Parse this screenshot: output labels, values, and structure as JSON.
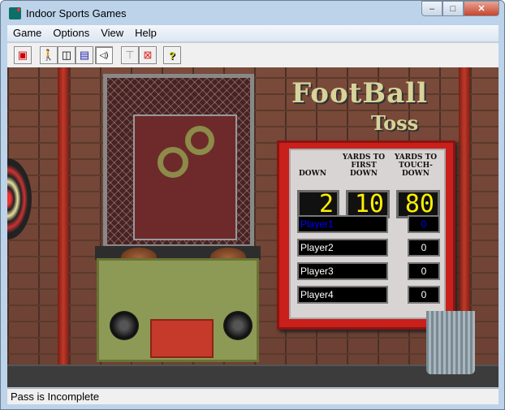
{
  "window": {
    "title": "Indoor Sports Games",
    "minimize": "–",
    "maximize": "□",
    "close": "✕"
  },
  "menu": [
    "Game",
    "Options",
    "View",
    "Help"
  ],
  "toolbar": [
    {
      "name": "new-game-icon",
      "glyph": "▣"
    },
    {
      "name": "player-icon",
      "glyph": "🚶"
    },
    {
      "name": "scoreboard-icon",
      "glyph": "◫"
    },
    {
      "name": "display-icon",
      "glyph": "▤"
    },
    {
      "name": "sound-icon",
      "glyph": "◁)"
    },
    {
      "name": "trophy-icon",
      "glyph": "⊤"
    },
    {
      "name": "no-target-icon",
      "glyph": "⊠"
    },
    {
      "name": "help-icon",
      "glyph": "?"
    }
  ],
  "game": {
    "logo_line1": "FootBall",
    "logo_line2": "Toss",
    "headers": {
      "down": "DOWN",
      "first_down": "YARDS TO FIRST DOWN",
      "touchdown": "YARDS TO TOUCH-DOWN"
    },
    "down": "2",
    "yards_first_down": "10",
    "yards_touchdown": "80",
    "players": [
      {
        "name": "Player1",
        "score": "0",
        "active": true
      },
      {
        "name": "Player2",
        "score": "0"
      },
      {
        "name": "Player3",
        "score": "0"
      },
      {
        "name": "Player4",
        "score": "0"
      }
    ],
    "active_color": "#0000ff"
  },
  "status": "Pass is Incomplete"
}
